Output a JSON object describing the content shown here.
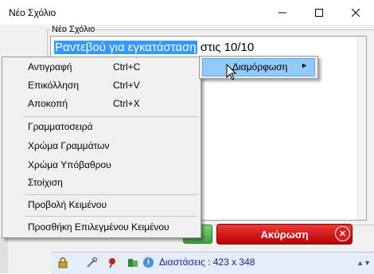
{
  "window": {
    "title": "Νέο Σχόλιο",
    "minimize_icon": "minimize-icon",
    "maximize_icon": "maximize-icon",
    "close_icon": "close-icon"
  },
  "group": {
    "label": "Νέο Σχόλιο"
  },
  "editor": {
    "selected_text": "Ραντεβού για εγκατάσταση",
    "rest_text": " στις 10/10"
  },
  "context_menu": {
    "items": [
      {
        "label": "Αντιγραφή",
        "shortcut": "Ctrl+C"
      },
      {
        "label": "Επικόλληση",
        "shortcut": "Ctrl+V"
      },
      {
        "label": "Αποκοπή",
        "shortcut": "Ctrl+X"
      },
      {
        "label": "Γραμματοσειρά",
        "shortcut": ""
      },
      {
        "label": "Χρώμα Γραμμάτων",
        "shortcut": ""
      },
      {
        "label": "Χρώμα Υπόβαθρου",
        "shortcut": ""
      },
      {
        "label": "Στοίχιση",
        "shortcut": ""
      },
      {
        "label": "Προβολή Κειμένου",
        "shortcut": ""
      },
      {
        "label": "Προσθήκη Επιλεγμένου Κειμένου",
        "shortcut": ""
      }
    ]
  },
  "submenu": {
    "label": "Διαμόρφωση",
    "arrow": "►"
  },
  "buttons": {
    "cancel_label": "Ακύρωση",
    "cancel_icon_glyph": "✕"
  },
  "statusbar": {
    "info_glyph": "i",
    "dimensions_text": "Διαστάσεις : 423 x 348",
    "grip_glyph": "▲▼"
  },
  "colors": {
    "selection": "#3399ff",
    "cancel": "#d01010",
    "ok": "#4caf50",
    "submenu_highlight": "#91c9f7"
  }
}
